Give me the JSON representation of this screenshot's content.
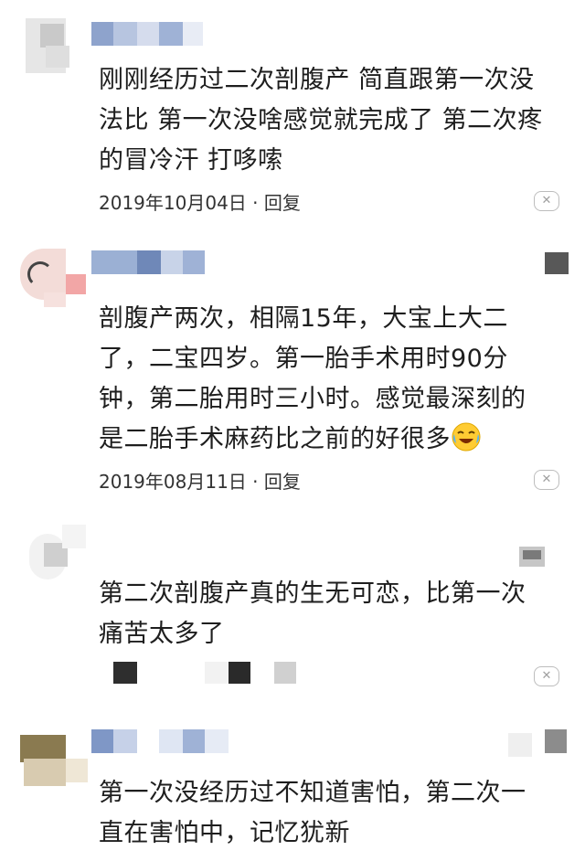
{
  "comments": [
    {
      "text": "刚刚经历过二次剖腹产 简直跟第一次没\n法比 第一次没啥感觉就完成了 第二次疼\n的冒冷汗 打哆嗦",
      "date": "2019年10月04日",
      "separator": "·",
      "reply_label": "回复",
      "close_icon": "close-icon"
    },
    {
      "text": "剖腹产两次，相隔15年，大宝上大二\n了，二宝四岁。第一胎手术用时90分\n钟，第二胎用时三小时。感觉最深刻的\n是二胎手术麻药比之前的好很多",
      "emoji": "crying-laughing-emoji",
      "date": "2019年08月11日",
      "separator": "·",
      "reply_label": "回复",
      "close_icon": "close-icon"
    },
    {
      "text": "第二次剖腹产真的生无可恋，比第一次\n痛苦太多了",
      "close_icon": "close-icon"
    },
    {
      "text": "第一次没经历过不知道害怕，第二次一\n直在害怕中，记忆犹新"
    }
  ],
  "colors": {
    "text": "#1e1e1e",
    "meta": "#333333",
    "blur_blue": "#8fa6cf",
    "blur_gray": "#cfcfcf"
  }
}
